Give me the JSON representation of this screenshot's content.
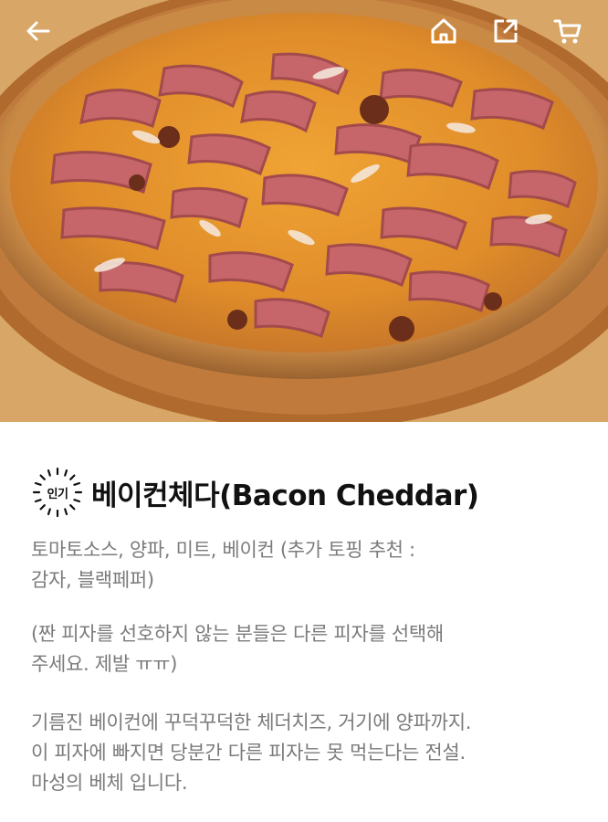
{
  "hero": {
    "image": "bacon-cheddar-pizza-photo"
  },
  "topbar": {
    "back_icon": "arrow-left-icon",
    "home_icon": "home-icon",
    "share_icon": "share-icon",
    "cart_icon": "cart-icon"
  },
  "product": {
    "badge": "인기",
    "name": "베이컨체다(Bacon Cheddar)",
    "ingredients_line1": "토마토소스, 양파, 미트, 베이컨 (추가 토핑 추천 :",
    "ingredients_line2": "감자, 블랙페퍼)",
    "note_line1": "(짠 피자를 선호하지 않는 분들은 다른 피자를 선택해",
    "note_line2": "주세요. 제발 ㅠㅠ)",
    "desc_line1": "기름진 베이컨에 꾸덕꾸덕한 체더치즈, 거기에 양파까지.",
    "desc_line2": "이 피자에 빠지면 당분간 다른 피자는 못 먹는다는 전설.",
    "desc_line3": "마성의 베체 입니다."
  },
  "colors": {
    "title": "#111111",
    "description": "#7b7b7b",
    "icon": "#ffffff"
  }
}
